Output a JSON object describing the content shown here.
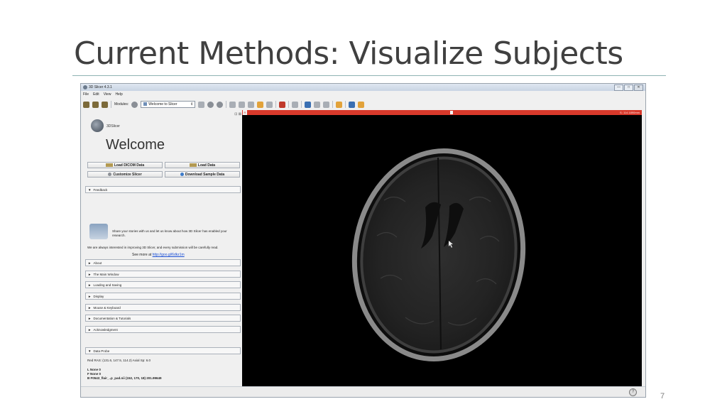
{
  "slide": {
    "title": "Current Methods: Visualize Subjects",
    "number": "7"
  },
  "window": {
    "title": "3D Slicer 4.3.1",
    "controls": {
      "minimize": "—",
      "maximize": "□",
      "close": "✕"
    }
  },
  "menu": {
    "items": [
      "File",
      "Edit",
      "View",
      "Help"
    ]
  },
  "toolbar": {
    "modules_label": "Modules:",
    "module_selected": "Welcome to Slicer",
    "module_arrow": "⇕"
  },
  "welcome_panel": {
    "corner_controls": "⊡ ⊠",
    "logo_text": "3DSlicer",
    "heading": "Welcome",
    "buttons": {
      "load_dicom": "Load DICOM Data",
      "load_data": "Load Data",
      "customize": "Customize Slicer",
      "download_sample": "Download Sample Data"
    }
  },
  "feedback": {
    "header": "Feedback",
    "text": "Share your stories with us and let us know about how 3D Slicer has enabled your research.",
    "note": "We are always interested in improving 3D Slicer, and every submission will be carefully read.",
    "see_more": "See more at",
    "link": "http://goo.gl/6dkz1m"
  },
  "sections": [
    "About",
    "The Main Window",
    "Loading and Saving",
    "Display",
    "Mouse & Keyboard",
    "Documentation & Tutorials",
    "Acknowledgment"
  ],
  "data_probe": {
    "header": "Data Probe",
    "line1": "Red  RAS: (131.6, 147.5, 114.2)  Axial Sp: 6.0",
    "line2": "L None                                   0",
    "line3": "F None                                   0",
    "line4": "B F0543_flair_..p_pad.nii (152, 170, 18) 201.99649"
  },
  "viewer": {
    "slider_tag": "R",
    "slice_offset": "S: 114.1890mm",
    "slider_position": 0.52
  },
  "icons": {
    "expanded": "▼",
    "collapsed": "►",
    "help": "?"
  },
  "colors": {
    "slider_red": "#d8392b",
    "link_blue": "#1a4fd6"
  }
}
